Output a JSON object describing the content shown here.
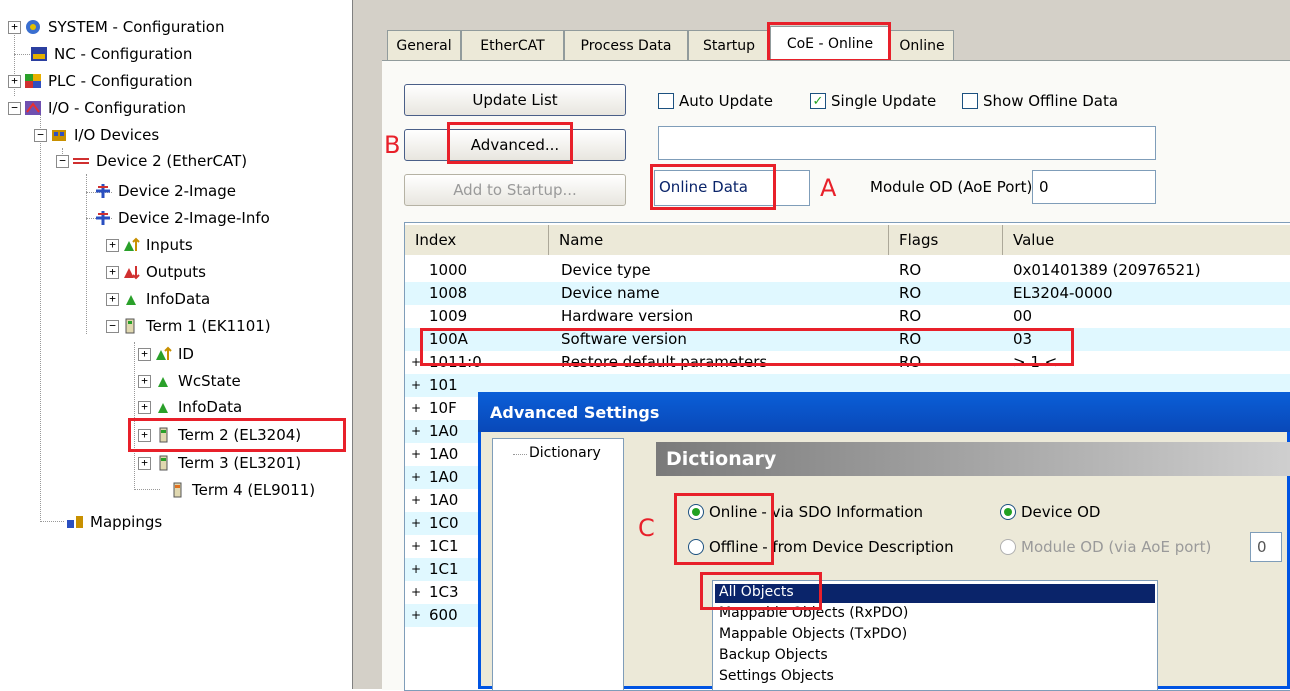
{
  "tree": {
    "items": [
      {
        "label": "SYSTEM - Configuration",
        "exp": "+"
      },
      {
        "label": "NC - Configuration",
        "exp": ""
      },
      {
        "label": "PLC - Configuration",
        "exp": "+"
      },
      {
        "label": "I/O - Configuration",
        "exp": "−"
      },
      {
        "label": "I/O Devices",
        "exp": "−"
      },
      {
        "label": "Device 2 (EtherCAT)",
        "exp": "−"
      },
      {
        "label": "Device 2-Image",
        "exp": ""
      },
      {
        "label": "Device 2-Image-Info",
        "exp": ""
      },
      {
        "label": "Inputs",
        "exp": "+"
      },
      {
        "label": "Outputs",
        "exp": "+"
      },
      {
        "label": "InfoData",
        "exp": "+"
      },
      {
        "label": "Term 1 (EK1101)",
        "exp": "−"
      },
      {
        "label": "ID",
        "exp": "+"
      },
      {
        "label": "WcState",
        "exp": "+"
      },
      {
        "label": "InfoData",
        "exp": "+"
      },
      {
        "label": "Term 2 (EL3204)",
        "exp": "+"
      },
      {
        "label": "Term 3 (EL3201)",
        "exp": "+"
      },
      {
        "label": "Term 4 (EL9011)",
        "exp": ""
      },
      {
        "label": "Mappings",
        "exp": ""
      }
    ]
  },
  "tabs": [
    "General",
    "EtherCAT",
    "Process Data",
    "Startup",
    "CoE - Online",
    "Online"
  ],
  "buttons": {
    "update_list": "Update List",
    "advanced": "Advanced...",
    "add_to_startup": "Add to Startup..."
  },
  "checkboxes": {
    "auto_update": "Auto Update",
    "single_update": "Single Update",
    "show_offline": "Show Offline Data"
  },
  "online_data": "Online Data",
  "module_od_label": "Module OD (AoE Port):",
  "module_od_value": "0",
  "annotations": {
    "a": "A",
    "b": "B",
    "c": "C"
  },
  "list": {
    "headers": {
      "index": "Index",
      "name": "Name",
      "flags": "Flags",
      "value": "Value"
    },
    "rows": [
      {
        "index": "1000",
        "name": "Device type",
        "flags": "RO",
        "value": "0x01401389 (20976521)",
        "exp": ""
      },
      {
        "index": "1008",
        "name": "Device name",
        "flags": "RO",
        "value": "EL3204-0000",
        "exp": ""
      },
      {
        "index": "1009",
        "name": "Hardware version",
        "flags": "RO",
        "value": "00",
        "exp": ""
      },
      {
        "index": "100A",
        "name": "Software version",
        "flags": "RO",
        "value": "03",
        "exp": ""
      },
      {
        "index": "1011:0",
        "name": "Restore default parameters",
        "flags": "RO",
        "value": "> 1 <",
        "exp": "+"
      },
      {
        "index": "101",
        "name": "",
        "flags": "",
        "value": "",
        "exp": "+"
      },
      {
        "index": "10F",
        "name": "",
        "flags": "",
        "value": "",
        "exp": "+"
      },
      {
        "index": "1A0",
        "name": "",
        "flags": "",
        "value": "",
        "exp": "+"
      },
      {
        "index": "1A0",
        "name": "",
        "flags": "",
        "value": "",
        "exp": "+"
      },
      {
        "index": "1A0",
        "name": "",
        "flags": "",
        "value": "",
        "exp": "+"
      },
      {
        "index": "1A0",
        "name": "",
        "flags": "",
        "value": "",
        "exp": "+"
      },
      {
        "index": "1C0",
        "name": "",
        "flags": "",
        "value": "",
        "exp": "+"
      },
      {
        "index": "1C1",
        "name": "",
        "flags": "",
        "value": "",
        "exp": "+"
      },
      {
        "index": "1C1",
        "name": "",
        "flags": "",
        "value": "",
        "exp": "+"
      },
      {
        "index": "1C3",
        "name": "",
        "flags": "",
        "value": "",
        "exp": "+"
      },
      {
        "index": "600",
        "name": "",
        "flags": "",
        "value": "",
        "exp": "+"
      }
    ]
  },
  "dialog": {
    "title": "Advanced Settings",
    "tree_item": "Dictionary",
    "section": "Dictionary",
    "online": "Online",
    "online_desc": "- via SDO Information",
    "offline": "Offline",
    "offline_desc": "- from Device Description",
    "device_od": "Device OD",
    "module_od": "Module OD (via AoE port)",
    "module_od_value": "0",
    "objects": [
      "All Objects",
      "Mappable Objects (RxPDO)",
      "Mappable Objects (TxPDO)",
      "Backup Objects",
      "Settings Objects"
    ]
  },
  "colors": {
    "accent": "#0054e3",
    "annotation": "#e8202a",
    "selection": "#0a246a",
    "row_alt": "#e0f8ff"
  }
}
